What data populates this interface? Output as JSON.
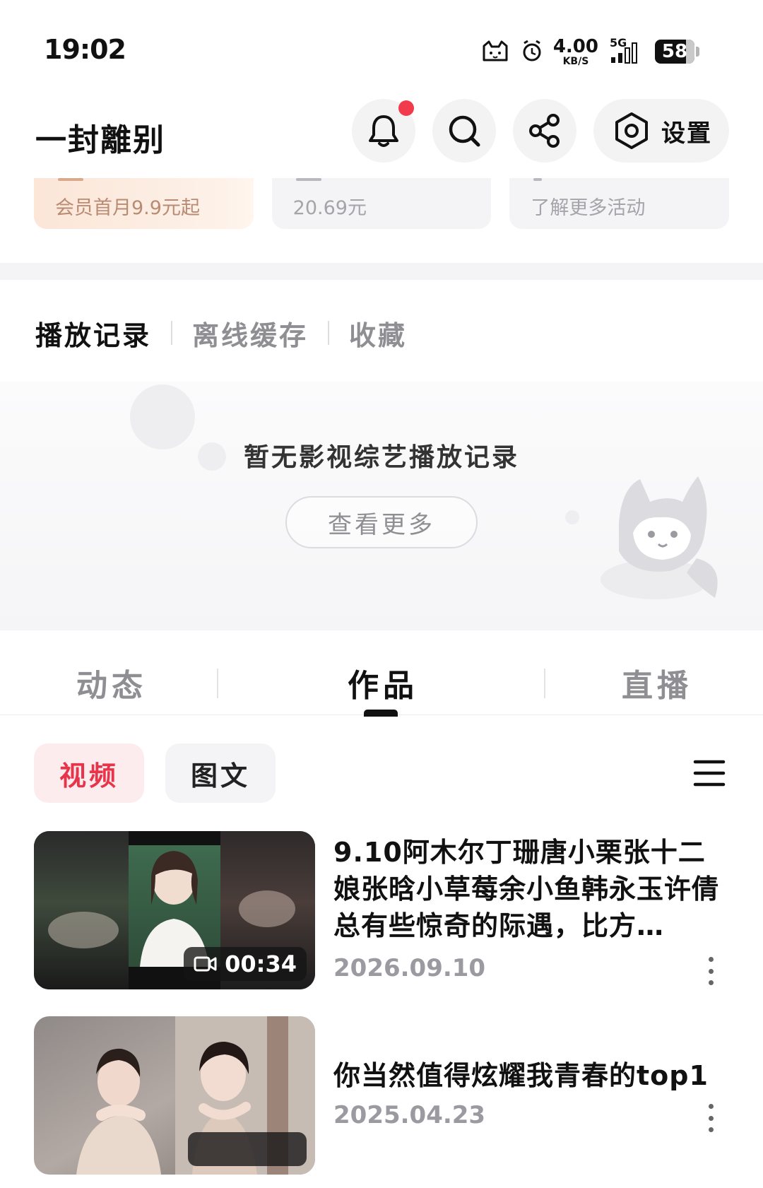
{
  "status_bar": {
    "time": "19:02",
    "net_speed_value": "4.00",
    "net_speed_unit": "KB/S",
    "network": "5G",
    "battery": "58",
    "icons": [
      "cat-notification-icon",
      "alarm-icon",
      "signal-icon",
      "battery-icon"
    ]
  },
  "header": {
    "username": "一封離别",
    "settings_label": "设置",
    "has_notification": true
  },
  "promos": [
    {
      "text": "会员首月9.9元起"
    },
    {
      "text": "20.69元"
    },
    {
      "text": "了解更多活动"
    }
  ],
  "history_tabs": [
    {
      "label": "播放记录",
      "active": true
    },
    {
      "label": "离线缓存",
      "active": false
    },
    {
      "label": "收藏",
      "active": false
    }
  ],
  "empty_state": {
    "message": "暂无影视综艺播放记录",
    "button_label": "查看更多"
  },
  "content_tabs": [
    {
      "label": "动态",
      "active": false
    },
    {
      "label": "作品",
      "active": true
    },
    {
      "label": "直播",
      "active": false
    }
  ],
  "filters": [
    {
      "label": "视频",
      "active": true
    },
    {
      "label": "图文",
      "active": false
    }
  ],
  "videos": [
    {
      "title": "9.10阿木尔丁珊唐小栗张十二娘张晗小草莓余小鱼韩永玉许倩 总有些惊奇的际遇，比方…",
      "date": "2026.09.10",
      "duration": "00:34"
    },
    {
      "title": "你当然值得炫耀我青春的top1",
      "date": "2025.04.23",
      "duration": ""
    }
  ],
  "colors": {
    "accent_red": "#e8344a",
    "notification_dot": "#f23a4d",
    "vip_text": "#b98b73"
  }
}
